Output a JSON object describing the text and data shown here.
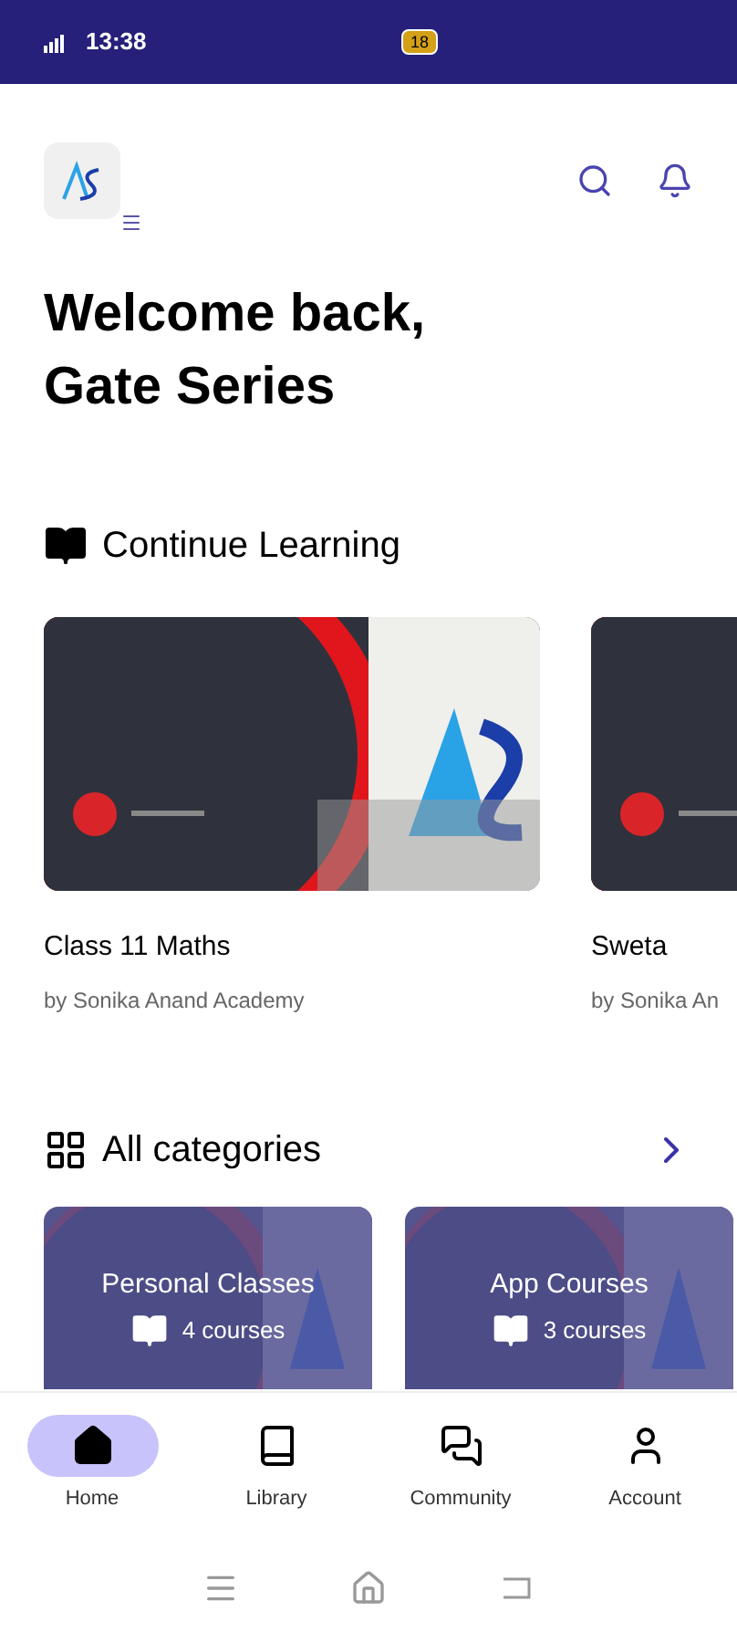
{
  "status_bar": {
    "time": "13:38",
    "battery": "18"
  },
  "header": {
    "greeting": "Welcome back,",
    "name": "Gate Series"
  },
  "continue_learning": {
    "title": "Continue Learning",
    "courses": [
      {
        "title": "Class 11 Maths",
        "author": "by Sonika Anand Academy"
      },
      {
        "title": "Sweta",
        "author": "by Sonika An"
      }
    ]
  },
  "categories": {
    "title": "All categories",
    "items": [
      {
        "name": "Personal Classes",
        "count": "4 courses"
      },
      {
        "name": "App Courses",
        "count": "3 courses"
      }
    ]
  },
  "nav": [
    {
      "label": "Home",
      "kind": "home",
      "selected": true
    },
    {
      "label": "Library",
      "kind": "library",
      "selected": false
    },
    {
      "label": "Community",
      "kind": "community",
      "selected": false
    },
    {
      "label": "Account",
      "kind": "account",
      "selected": false
    }
  ]
}
